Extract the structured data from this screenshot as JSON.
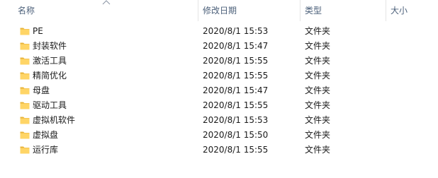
{
  "columns": {
    "name": "名称",
    "date_modified": "修改日期",
    "type": "类型",
    "size": "大小"
  },
  "sort": {
    "column": "name",
    "direction": "ascending"
  },
  "files": [
    {
      "name": "PE",
      "date_modified": "2020/8/1 15:53",
      "type": "文件夹"
    },
    {
      "name": "封装软件",
      "date_modified": "2020/8/1 15:47",
      "type": "文件夹"
    },
    {
      "name": "激活工具",
      "date_modified": "2020/8/1 15:55",
      "type": "文件夹"
    },
    {
      "name": "精简优化",
      "date_modified": "2020/8/1 15:55",
      "type": "文件夹"
    },
    {
      "name": "母盘",
      "date_modified": "2020/8/1 15:47",
      "type": "文件夹"
    },
    {
      "name": "驱动工具",
      "date_modified": "2020/8/1 15:55",
      "type": "文件夹"
    },
    {
      "name": "虚拟机软件",
      "date_modified": "2020/8/1 15:53",
      "type": "文件夹"
    },
    {
      "name": "虚拟盘",
      "date_modified": "2020/8/1 15:50",
      "type": "文件夹"
    },
    {
      "name": "运行库",
      "date_modified": "2020/8/1 15:55",
      "type": "文件夹"
    }
  ],
  "icons": {
    "folder": "folder-icon",
    "sort": "sort-ascending-icon"
  },
  "colors": {
    "header_text": "#4c607a",
    "folder_body": "#ffd566",
    "folder_tab": "#e8b43a",
    "divider": "#e5e5e5"
  }
}
